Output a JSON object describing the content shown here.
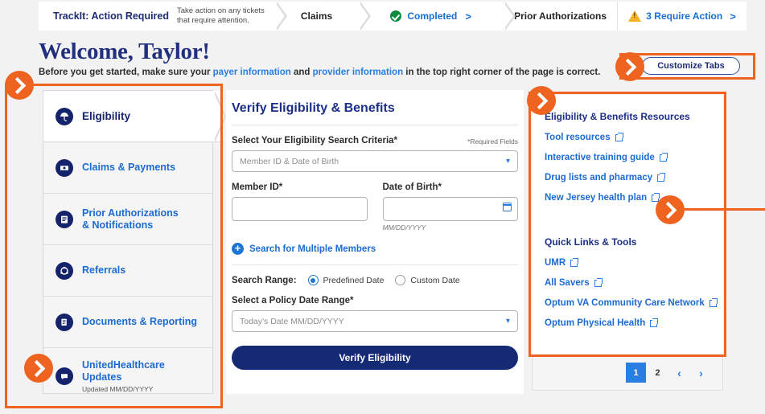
{
  "topnav": {
    "segments": [
      {
        "title": "TrackIt: Action Required",
        "subtitle": "Take action on any tickets\nthat require attention.",
        "icon": "none"
      },
      {
        "label": "Claims",
        "icon": "none"
      },
      {
        "label": "Completed",
        "icon": "check-circle-icon",
        "chevron": ">"
      },
      {
        "label": "Prior Authorizations",
        "icon": "none"
      },
      {
        "label": "3 Require Action",
        "icon": "warning-triangle-icon",
        "chevron": ">"
      }
    ]
  },
  "header": {
    "welcome": "Welcome, Taylor!",
    "sub_before": "Before you get started, make sure your ",
    "link_payer": "payer information",
    "sub_mid": " and ",
    "link_provider": "provider information",
    "sub_after": " in the top right corner of the page is correct.",
    "customize_tabs": "Customize Tabs"
  },
  "sidebar": {
    "items": [
      {
        "label": "Eligibility",
        "icon": "umbrella-icon",
        "active": true
      },
      {
        "label": "Claims & Payments",
        "icon": "payment-icon",
        "active": false
      },
      {
        "label": "Prior Authorizations\n& Notifications",
        "icon": "clipboard-icon",
        "active": false
      },
      {
        "label": "Referrals",
        "icon": "referral-icon",
        "active": false
      },
      {
        "label": "Documents & Reporting",
        "icon": "documents-icon",
        "active": false
      },
      {
        "label": "UnitedHealthcare\nUpdates",
        "icon": "chat-bubble-icon",
        "active": false,
        "sub": "Updated MM/DD/YYYY"
      }
    ]
  },
  "form": {
    "title": "Verify Eligibility & Benefits",
    "criteria_label": "Select Your Eligibility Search Criteria*",
    "required_note": "*Required Fields",
    "criteria_value": "Member ID & Date of Birth",
    "member_id_label": "Member ID*",
    "member_id_value": "",
    "member_id_placeholder": "",
    "dob_label": "Date of Birth*",
    "dob_value": "",
    "dob_placeholder": "",
    "dob_hint": "MM/DD/YYYY",
    "multi_link": "Search for Multiple Members",
    "search_range_label": "Search Range:",
    "radio_predefined": "Predefined Date",
    "radio_custom": "Custom Date",
    "radio_selected": "Predefined Date",
    "policy_label": "Select a Policy Date Range*",
    "policy_value": "Today's Date MM/DD/YYYY",
    "verify_button": "Verify Eligibility"
  },
  "right_panel": {
    "resources_heading": "Eligibility & Benefits Resources",
    "resources": [
      "Tool resources",
      "Interactive training guide",
      "Drug lists and pharmacy",
      "New Jersey health plan"
    ],
    "quicklinks_heading": "Quick Links & Tools",
    "quicklinks": [
      "UMR",
      "All Savers",
      "Optum VA Community Care Network",
      "Optum Physical Health"
    ]
  },
  "pagination": {
    "pages": [
      "1",
      "2"
    ],
    "current": "1",
    "prev": "‹",
    "next": "›"
  },
  "colors": {
    "accent_orange": "#ef6321",
    "brand_navy": "#152a75",
    "link_blue": "#1d6bd0",
    "success_green": "#0d8a3e",
    "warning_yellow": "#f5b223"
  }
}
